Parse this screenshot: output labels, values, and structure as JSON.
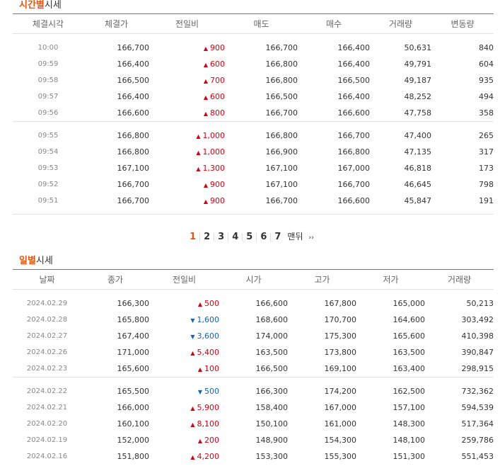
{
  "time_section": {
    "title_highlight": "시간별",
    "title_rest": "시세",
    "headers": [
      "체결시각",
      "체결가",
      "전일비",
      "매도",
      "매수",
      "거래량",
      "변동량"
    ],
    "groups": [
      [
        {
          "time": "10:00",
          "price": "166,700",
          "dir": "up",
          "diff": "900",
          "ask": "166,700",
          "bid": "166,400",
          "volume": "50,631",
          "change": "840"
        },
        {
          "time": "09:59",
          "price": "166,400",
          "dir": "up",
          "diff": "600",
          "ask": "166,800",
          "bid": "166,400",
          "volume": "49,791",
          "change": "604"
        },
        {
          "time": "09:58",
          "price": "166,500",
          "dir": "up",
          "diff": "700",
          "ask": "166,800",
          "bid": "166,500",
          "volume": "49,187",
          "change": "935"
        },
        {
          "time": "09:57",
          "price": "166,400",
          "dir": "up",
          "diff": "600",
          "ask": "166,500",
          "bid": "166,400",
          "volume": "48,252",
          "change": "494"
        },
        {
          "time": "09:56",
          "price": "166,600",
          "dir": "up",
          "diff": "800",
          "ask": "166,700",
          "bid": "166,600",
          "volume": "47,758",
          "change": "358"
        }
      ],
      [
        {
          "time": "09:55",
          "price": "166,800",
          "dir": "up",
          "diff": "1,000",
          "ask": "166,800",
          "bid": "166,700",
          "volume": "47,400",
          "change": "265"
        },
        {
          "time": "09:54",
          "price": "166,800",
          "dir": "up",
          "diff": "1,000",
          "ask": "166,900",
          "bid": "166,800",
          "volume": "47,135",
          "change": "317"
        },
        {
          "time": "09:53",
          "price": "167,100",
          "dir": "up",
          "diff": "1,300",
          "ask": "167,100",
          "bid": "167,000",
          "volume": "46,818",
          "change": "173"
        },
        {
          "time": "09:52",
          "price": "166,700",
          "dir": "up",
          "diff": "900",
          "ask": "167,100",
          "bid": "166,700",
          "volume": "46,645",
          "change": "798"
        },
        {
          "time": "09:51",
          "price": "166,700",
          "dir": "up",
          "diff": "900",
          "ask": "166,700",
          "bid": "166,600",
          "volume": "45,847",
          "change": "191"
        }
      ]
    ]
  },
  "pagination": {
    "pages": [
      "1",
      "2",
      "3",
      "4",
      "5",
      "6",
      "7"
    ],
    "current": "1",
    "last_label": "맨뒤",
    "next_glyph": "››"
  },
  "daily_section": {
    "title_highlight": "일별",
    "title_rest": "시세",
    "headers": [
      "날짜",
      "종가",
      "전일비",
      "시가",
      "고가",
      "저가",
      "거래량"
    ],
    "groups": [
      [
        {
          "date": "2024.02.29",
          "close": "166,300",
          "dir": "up",
          "diff": "500",
          "open": "166,600",
          "high": "167,800",
          "low": "165,000",
          "volume": "50,213"
        },
        {
          "date": "2024.02.28",
          "close": "165,800",
          "dir": "down",
          "diff": "1,600",
          "open": "168,600",
          "high": "170,700",
          "low": "164,600",
          "volume": "303,492"
        },
        {
          "date": "2024.02.27",
          "close": "167,400",
          "dir": "down",
          "diff": "3,600",
          "open": "174,000",
          "high": "175,300",
          "low": "165,600",
          "volume": "410,398"
        },
        {
          "date": "2024.02.26",
          "close": "171,000",
          "dir": "up",
          "diff": "5,400",
          "open": "163,500",
          "high": "173,800",
          "low": "163,500",
          "volume": "390,847"
        },
        {
          "date": "2024.02.23",
          "close": "165,600",
          "dir": "up",
          "diff": "100",
          "open": "166,500",
          "high": "169,100",
          "low": "163,400",
          "volume": "298,915"
        }
      ],
      [
        {
          "date": "2024.02.22",
          "close": "165,500",
          "dir": "down",
          "diff": "500",
          "open": "166,300",
          "high": "174,200",
          "low": "162,500",
          "volume": "732,362"
        },
        {
          "date": "2024.02.21",
          "close": "166,000",
          "dir": "up",
          "diff": "5,900",
          "open": "158,400",
          "high": "167,000",
          "low": "157,100",
          "volume": "594,539"
        },
        {
          "date": "2024.02.20",
          "close": "160,100",
          "dir": "up",
          "diff": "8,100",
          "open": "150,100",
          "high": "161,000",
          "low": "148,300",
          "volume": "517,364"
        },
        {
          "date": "2024.02.19",
          "close": "152,000",
          "dir": "up",
          "diff": "200",
          "open": "148,900",
          "high": "154,300",
          "low": "148,100",
          "volume": "259,786"
        },
        {
          "date": "2024.02.16",
          "close": "151,800",
          "dir": "up",
          "diff": "4,200",
          "open": "153,300",
          "high": "155,300",
          "low": "151,300",
          "volume": "551,453"
        }
      ]
    ]
  },
  "colors": {
    "up": "#d6000f",
    "down": "#1261c4",
    "accent": "#e8530f"
  },
  "glyphs": {
    "up": "▲",
    "down": "▼"
  }
}
